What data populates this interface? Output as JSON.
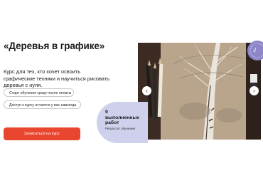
{
  "hero": {
    "title": "«Деревья в графике»",
    "description": "Курс для тех, кто хочет освоить графические техники и научиться рисовать деревья с нуля.",
    "pills": [
      "Старт обучения сразу после оплаты",
      "Доступ к курсу остается у вас навсегда"
    ],
    "cta_label": "Записаться на курс"
  },
  "stat": {
    "number_text": "9 выполненных работ",
    "caption": "Результат обучения"
  },
  "carousel": {
    "prev_icon": "chevron-left-icon",
    "next_icon": "chevron-right-icon"
  },
  "colors": {
    "accent": "#e8462f",
    "stat_bg": "#cfd0ec",
    "badge": "#8d86c9"
  }
}
